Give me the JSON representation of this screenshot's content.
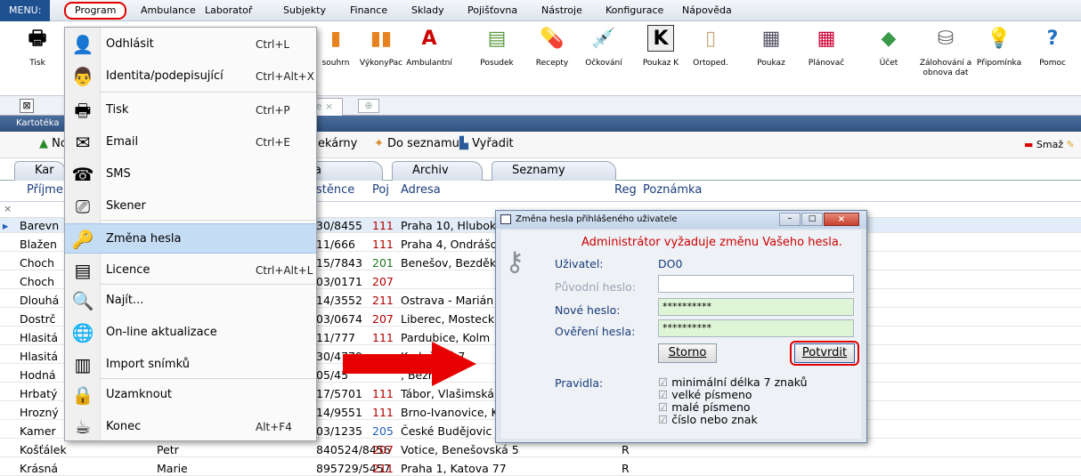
{
  "menubar": {
    "items": [
      "MENU:",
      "Program",
      "Ambulance",
      "Laboratoř",
      "Subjekty",
      "Finance",
      "Sklady",
      "Pojišťovna",
      "Nástroje",
      "Konfigurace",
      "Nápověda"
    ]
  },
  "toolbar": {
    "items": [
      {
        "label": "Tisk",
        "icon": "printer-icon"
      },
      {
        "label": "souhrn",
        "icon": "chart-icon"
      },
      {
        "label": "VýkonyPac",
        "icon": "chart-icon"
      },
      {
        "label": "Ambulantní",
        "icon": "letter-a-icon"
      },
      {
        "label": "Posudek",
        "icon": "document-icon"
      },
      {
        "label": "Recepty",
        "icon": "pill-icon"
      },
      {
        "label": "Očkování",
        "icon": "syringe-icon"
      },
      {
        "label": "Poukaz K",
        "icon": "letter-k-icon"
      },
      {
        "label": "Ortoped.",
        "icon": "ortho-icon"
      },
      {
        "label": "Poukaz",
        "icon": "form-icon"
      },
      {
        "label": "Plánovač",
        "icon": "calendar-icon"
      },
      {
        "label": "Účet",
        "icon": "money-icon"
      },
      {
        "label": "Zálohování a obnova dat",
        "icon": "backup-icon"
      },
      {
        "label": "Připomínka",
        "icon": "bulb-icon"
      },
      {
        "label": "Pomoc",
        "icon": "help-icon"
      }
    ]
  },
  "tabs": {
    "partial_tab": "ěde",
    "close_glyph": "×",
    "add_glyph": "⊕"
  },
  "kartoteka": {
    "title": "Kartotéka"
  },
  "actionbar": {
    "new_label": "No",
    "lekarny_label": "ekárny",
    "do_seznamu_label": "Do seznamu",
    "vyradit_label": "Vyřadit",
    "smaz_label": "Smaž"
  },
  "subtabs": [
    "Kar",
    "a",
    "Archiv",
    "Seznamy"
  ],
  "grid": {
    "columns": [
      "Příjmer",
      "stěnce",
      "Poj",
      "Adresa",
      "Reg",
      "Poznámka"
    ],
    "rows": [
      {
        "surname": "Barevn",
        "first": "",
        "rc": "30/8455",
        "poj": "111",
        "addr": "Praha 10, Hlubok",
        "reg": ""
      },
      {
        "surname": "Blažen",
        "first": "",
        "rc": "11/666",
        "poj": "111",
        "addr": "Praha 4, Ondrášo",
        "reg": ""
      },
      {
        "surname": "Choch",
        "first": "",
        "rc": "15/7843",
        "poj": "201",
        "addr": "Benešov, Bezděk",
        "reg": ""
      },
      {
        "surname": "Choch",
        "first": "",
        "rc": "03/0171",
        "poj": "207",
        "addr": "",
        "reg": ""
      },
      {
        "surname": "Dlouhá",
        "first": "",
        "rc": "14/3552",
        "poj": "211",
        "addr": "Ostrava - Marián",
        "reg": ""
      },
      {
        "surname": "Dostrč",
        "first": "",
        "rc": "03/0674",
        "poj": "207",
        "addr": "Liberec, Mosteck",
        "reg": ""
      },
      {
        "surname": "Hlasitá",
        "first": "",
        "rc": "11/777",
        "poj": "111",
        "addr": "Pardubice, Kolm",
        "reg": ""
      },
      {
        "surname": "Hlasitá",
        "first": "",
        "rc": "30/4779",
        "poj": "",
        "addr": "Kadaňská 7",
        "reg": ""
      },
      {
        "surname": "Hodná",
        "first": "",
        "rc": "05/45",
        "poj": "",
        "addr": ", Bezruč",
        "reg": ""
      },
      {
        "surname": "Hrbatý",
        "first": "",
        "rc": "17/5701",
        "poj": "111",
        "addr": "Tábor, Vlašimská",
        "reg": ""
      },
      {
        "surname": "Hrozný",
        "first": "",
        "rc": "14/9551",
        "poj": "111",
        "addr": "Brno-Ivanovice, K",
        "reg": ""
      },
      {
        "surname": "Kamer",
        "first": "",
        "rc": "03/1235",
        "poj": "205",
        "addr": "České Budějovic",
        "reg": ""
      },
      {
        "surname": "Košťálek",
        "first": "Petr",
        "rc": "840524/8456",
        "poj": "207",
        "addr": "Votice, Benešovská 5",
        "reg": "R"
      },
      {
        "surname": "Krásná",
        "first": "Marie",
        "rc": "895729/5457",
        "poj": "211",
        "addr": "Praha 1, Katova 77",
        "reg": "R"
      }
    ]
  },
  "menu": {
    "items": [
      {
        "label": "Odhlásit",
        "shortcut": "Ctrl+L",
        "icon": "user-logout-icon"
      },
      {
        "label": "Identita/podepisující",
        "shortcut": "Ctrl+Alt+X",
        "icon": "doctor-icon"
      },
      {
        "label": "Tisk",
        "shortcut": "Ctrl+P",
        "icon": "printer-icon"
      },
      {
        "label": "Email",
        "shortcut": "Ctrl+E",
        "icon": "envelope-icon"
      },
      {
        "label": "SMS",
        "shortcut": "",
        "icon": "phone-icon"
      },
      {
        "label": "Skener",
        "shortcut": "",
        "icon": "scanner-icon"
      },
      {
        "label": "Změna hesla",
        "shortcut": "",
        "icon": "key-icon"
      },
      {
        "label": "Licence",
        "shortcut": "Ctrl+Alt+L",
        "icon": "license-icon"
      },
      {
        "label": "Najít...",
        "shortcut": "",
        "icon": "magnifier-icon"
      },
      {
        "label": "On-line aktualizace",
        "shortcut": "",
        "icon": "globe-icon"
      },
      {
        "label": "Import snímků",
        "shortcut": "",
        "icon": "film-icon"
      },
      {
        "label": "Uzamknout",
        "shortcut": "",
        "icon": "padlock-icon"
      },
      {
        "label": "Konec",
        "shortcut": "Alt+F4",
        "icon": "cup-icon"
      }
    ]
  },
  "dialog": {
    "title": "Změna hesla přihlášeného uživatele",
    "message": "Administrátor vyžaduje změnu Vašeho hesla.",
    "user_label": "Uživatel:",
    "user_value": "DO0",
    "old_label": "Původní heslo:",
    "old_value": "",
    "new_label": "Nové heslo:",
    "new_value": "**********",
    "verify_label": "Ověření hesla:",
    "verify_value": "**********",
    "cancel_label": "Storno",
    "confirm_label": "Potvrdit",
    "rules_label": "Pravidla:",
    "rules": [
      "minimální délka 7 znaků",
      "velké písmeno",
      "malé písmeno",
      "číslo nebo znak"
    ]
  },
  "colors": {
    "highlight_red": "#e00000",
    "menu_highlight": "#c5dcf5",
    "dialog_message": "#cc0000",
    "field_green": "#dff6d6",
    "titlebar_blue": "#2f527f"
  }
}
